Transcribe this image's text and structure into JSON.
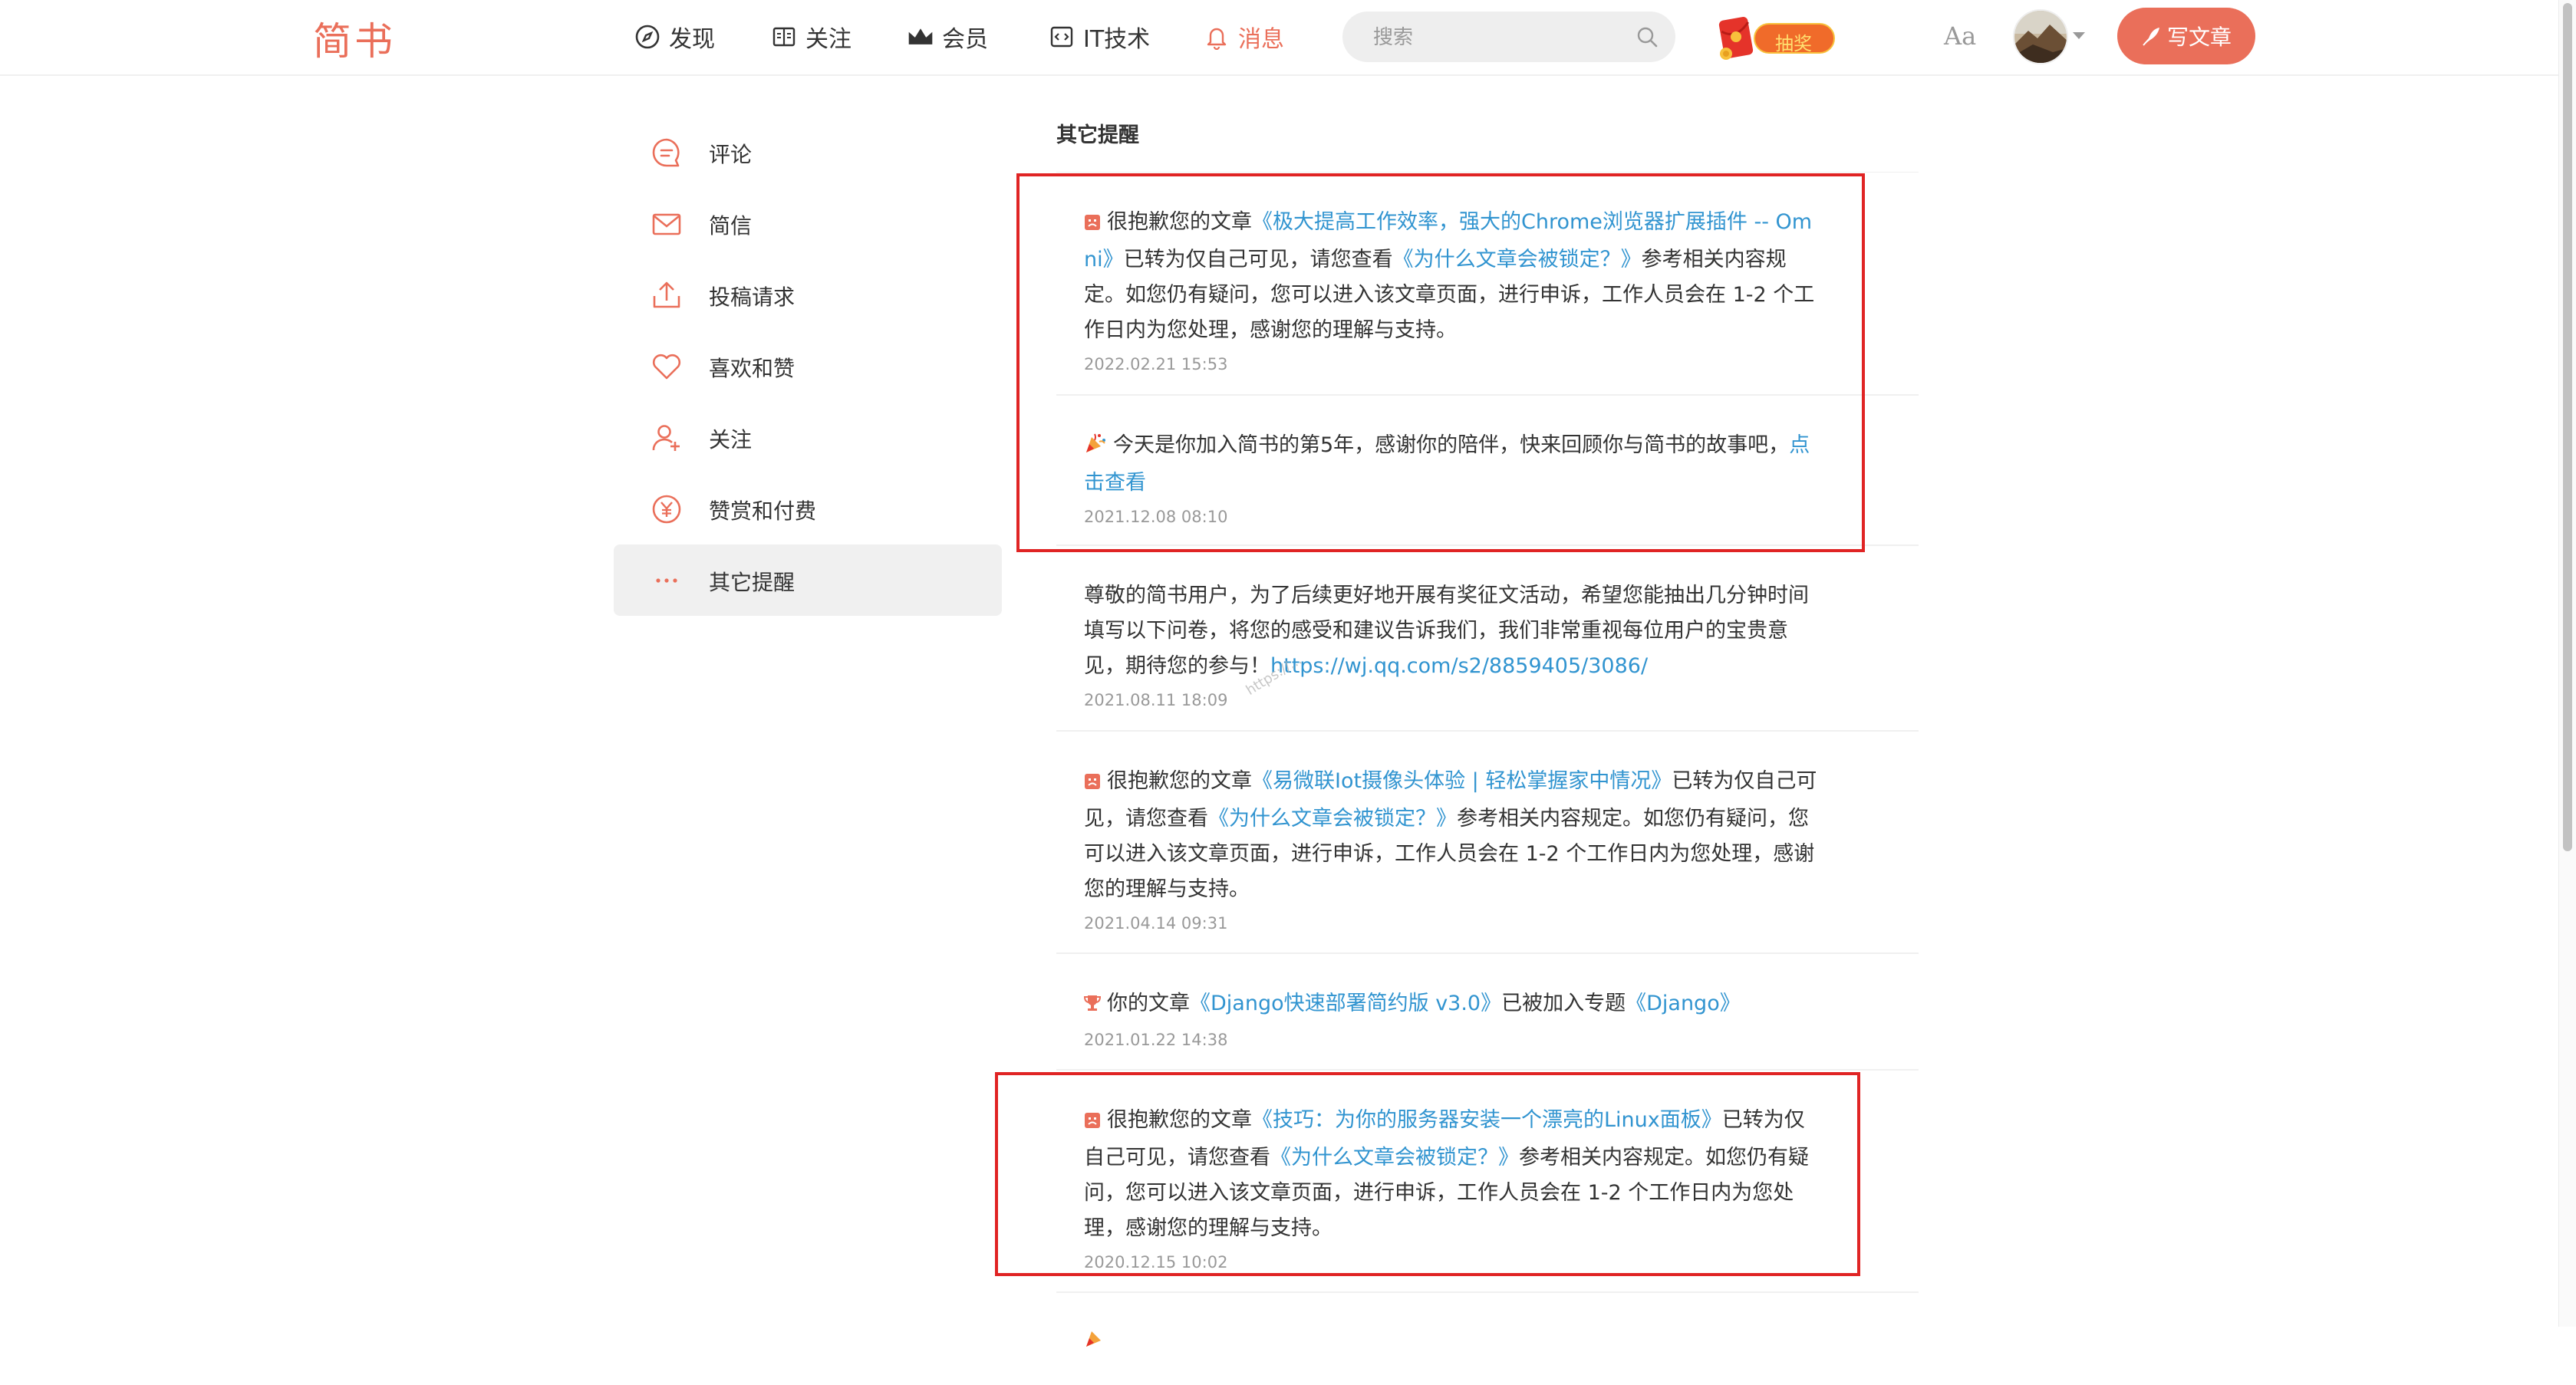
{
  "brand": {
    "logo": "简书",
    "accent": "#ea6f5a",
    "link": "#3194d0"
  },
  "nav": {
    "discover": "发现",
    "follow": "关注",
    "member": "会员",
    "it": "IT技术",
    "messages": "消息"
  },
  "search": {
    "placeholder": "搜索"
  },
  "lottery": {
    "label": "抽奖"
  },
  "font_toggle": "Aa",
  "write_button": "写文章",
  "sidebar": {
    "items": [
      {
        "label": "评论",
        "icon": "comment-icon"
      },
      {
        "label": "简信",
        "icon": "mail-icon"
      },
      {
        "label": "投稿请求",
        "icon": "upload-icon"
      },
      {
        "label": "喜欢和赞",
        "icon": "heart-icon"
      },
      {
        "label": "关注",
        "icon": "add-user-icon"
      },
      {
        "label": "赞赏和付费",
        "icon": "yen-icon"
      },
      {
        "label": "其它提醒",
        "icon": "more-icon",
        "active": true
      }
    ]
  },
  "main": {
    "title": "其它提醒",
    "notices": [
      {
        "icon": "sad-face-icon",
        "pre": "很抱歉您的文章",
        "link1": "《极大提高工作效率，强大的Chrome浏览器扩展插件 -- Omni》",
        "mid": "已转为仅自己可见，请您查看",
        "link2": "《为什么文章会被锁定？》",
        "post": "参考相关内容规定。如您仍有疑问，您可以进入该文章页面，进行申诉，工作人员会在 1-2 个工作日内为您处理，感谢您的理解与支持。",
        "time": "2022.02.21 15:53"
      },
      {
        "icon": "party-icon",
        "pre": "今天是你加入简书的第5年，感谢你的陪伴，快来回顾你与简书的故事吧，",
        "link1": "点击查看",
        "time": "2021.12.08 08:10"
      },
      {
        "pre": "尊敬的简书用户，为了后续更好地开展有奖征文活动，希望您能抽出几分钟时间填写以下问卷，将您的感受和建议告诉我们，我们非常重视每位用户的宝贵意见，期待您的参与！",
        "link1": "https://wj.qq.com/s2/8859405/3086/",
        "time": "2021.08.11 18:09"
      },
      {
        "icon": "sad-face-icon",
        "pre": "很抱歉您的文章",
        "link1": "《易微联Iot摄像头体验 | 轻松掌握家中情况》",
        "mid": "已转为仅自己可见，请您查看",
        "link2": "《为什么文章会被锁定？》",
        "post": "参考相关内容规定。如您仍有疑问，您可以进入该文章页面，进行申诉，工作人员会在 1-2 个工作日内为您处理，感谢您的理解与支持。",
        "time": "2021.04.14 09:31"
      },
      {
        "icon": "trophy-icon",
        "pre": "你的文章",
        "link1": "《Django快速部署简约版 v3.0》",
        "mid": "已被加入专题",
        "link2": "《Django》",
        "time": "2021.01.22 14:38"
      },
      {
        "icon": "sad-face-icon",
        "pre": "很抱歉您的文章",
        "link1": "《技巧：为你的服务器安装一个漂亮的Linux面板》",
        "mid": "已转为仅自己可见，请您查看",
        "link2": "《为什么文章会被锁定？》",
        "post": "参考相关内容规定。如您仍有疑问，您可以进入该文章页面，进行申诉，工作人员会在 1-2 个工作日内为您处理，感谢您的理解与支持。",
        "time": "2020.12.15 10:02"
      }
    ]
  },
  "watermark": "https://..."
}
